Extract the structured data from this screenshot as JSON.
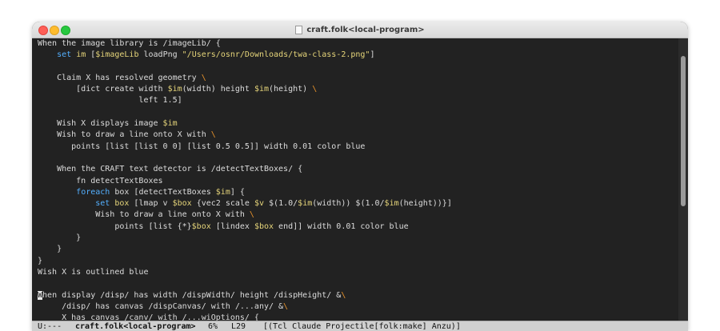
{
  "window": {
    "title": "craft.folk<local-program>"
  },
  "colors": {
    "default": "#dcdcdc",
    "variable": "#e6d57a",
    "string": "#e6d57a",
    "keyword": "#54b0ff",
    "continuation": "#e8932b"
  },
  "code_lines": [
    [
      {
        "t": "When the image library is /imageLib/ {"
      }
    ],
    [
      {
        "t": "    "
      },
      {
        "t": "set",
        "k": "keyword"
      },
      {
        "t": " "
      },
      {
        "t": "im",
        "k": "variable"
      },
      {
        "t": " ["
      },
      {
        "t": "$imageLib",
        "k": "variable"
      },
      {
        "t": " loadPng "
      },
      {
        "t": "\"/Users/osnr/Downloads/twa-class-2.png\"",
        "k": "string"
      },
      {
        "t": "]"
      }
    ],
    [
      {
        "t": ""
      }
    ],
    [
      {
        "t": "    Claim X has resolved geometry "
      },
      {
        "t": "\\",
        "k": "continuation"
      }
    ],
    [
      {
        "t": "        [dict create width "
      },
      {
        "t": "$im",
        "k": "variable"
      },
      {
        "t": "(width) height "
      },
      {
        "t": "$im",
        "k": "variable"
      },
      {
        "t": "(height) "
      },
      {
        "t": "\\",
        "k": "continuation"
      }
    ],
    [
      {
        "t": "                     left 1.5]"
      }
    ],
    [
      {
        "t": ""
      }
    ],
    [
      {
        "t": "    Wish X displays image "
      },
      {
        "t": "$im",
        "k": "variable"
      }
    ],
    [
      {
        "t": "    Wish to draw a line onto X with "
      },
      {
        "t": "\\",
        "k": "continuation"
      }
    ],
    [
      {
        "t": "       points [list [list 0 0] [list 0.5 0.5]] width 0.01 color blue"
      }
    ],
    [
      {
        "t": ""
      }
    ],
    [
      {
        "t": "    When the CRAFT text detector is /detectTextBoxes/ {"
      }
    ],
    [
      {
        "t": "        fn detectTextBoxes"
      }
    ],
    [
      {
        "t": "        "
      },
      {
        "t": "foreach",
        "k": "keyword"
      },
      {
        "t": " box [detectTextBoxes "
      },
      {
        "t": "$im",
        "k": "variable"
      },
      {
        "t": "] {"
      }
    ],
    [
      {
        "t": "            "
      },
      {
        "t": "set",
        "k": "keyword"
      },
      {
        "t": " "
      },
      {
        "t": "box",
        "k": "variable"
      },
      {
        "t": " [lmap v "
      },
      {
        "t": "$box",
        "k": "variable"
      },
      {
        "t": " {vec2 scale "
      },
      {
        "t": "$v",
        "k": "variable"
      },
      {
        "t": " $(1.0/"
      },
      {
        "t": "$im",
        "k": "variable"
      },
      {
        "t": "(width)) $(1.0/"
      },
      {
        "t": "$im",
        "k": "variable"
      },
      {
        "t": "(height))}]"
      }
    ],
    [
      {
        "t": "            Wish to draw a line onto X with "
      },
      {
        "t": "\\",
        "k": "continuation"
      }
    ],
    [
      {
        "t": "                points [list {*}"
      },
      {
        "t": "$box",
        "k": "variable"
      },
      {
        "t": " [lindex "
      },
      {
        "t": "$box",
        "k": "variable"
      },
      {
        "t": " end]] width 0.01 color blue"
      }
    ],
    [
      {
        "t": "        }"
      }
    ],
    [
      {
        "t": "    }"
      }
    ],
    [
      {
        "t": "}"
      }
    ],
    [
      {
        "t": "Wish X is outlined blue"
      }
    ],
    [
      {
        "t": ""
      }
    ],
    [
      {
        "t": "W",
        "k": "cursor"
      },
      {
        "t": "hen display /disp/ has width /dispWidth/ height /dispHeight/ &"
      },
      {
        "t": "\\",
        "k": "continuation"
      }
    ],
    [
      {
        "t": "     /disp/ has canvas /dispCanvas/ with /...any/ &"
      },
      {
        "t": "\\",
        "k": "continuation"
      }
    ],
    [
      {
        "t": "     X has canvas /canv/ with /...wiOptions/ {"
      }
    ]
  ],
  "modeline": {
    "state": "U:---",
    "buffer": "craft.folk<local-program>",
    "percent": "6%",
    "line": "L29",
    "modes": "[(Tcl Claude Projectile[folk:make] Anzu)]"
  }
}
